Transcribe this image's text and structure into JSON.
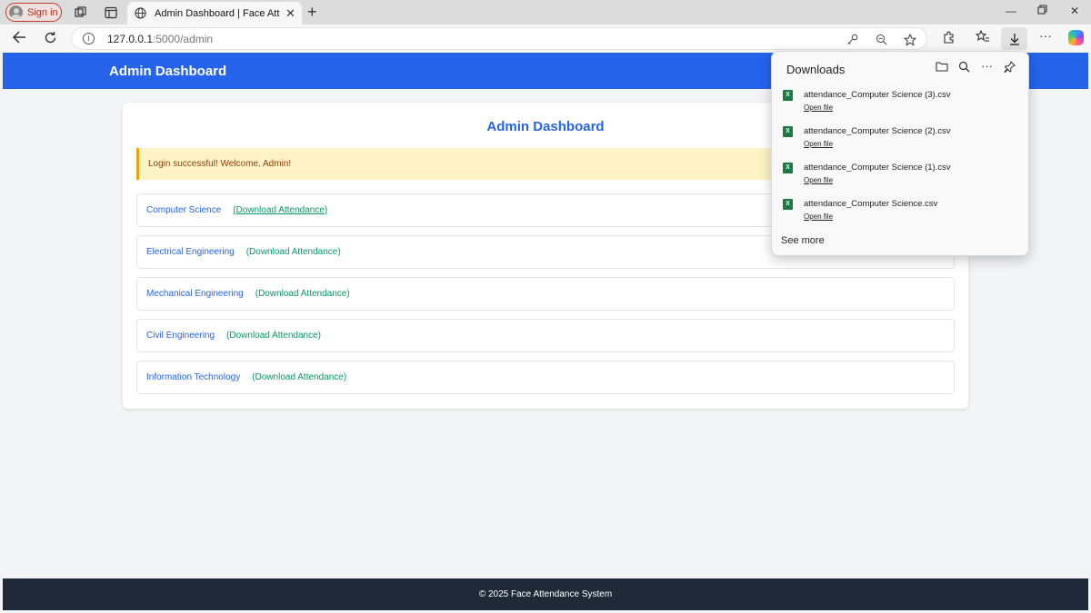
{
  "browser": {
    "signin_label": "Sign in",
    "tab_title": "Admin Dashboard | Face Attendance System",
    "url_host": "127.0.0.1",
    "url_path": ":5000/admin"
  },
  "header": {
    "brand": "Admin Dashboard"
  },
  "card": {
    "heading": "Admin Dashboard",
    "alert": "Login successful! Welcome, Admin!",
    "departments": [
      {
        "name": "Computer Science",
        "link": "(Download Attendance)"
      },
      {
        "name": "Electrical Engineering",
        "link": "(Download Attendance)"
      },
      {
        "name": "Mechanical Engineering",
        "link": "(Download Attendance)"
      },
      {
        "name": "Civil Engineering",
        "link": "(Download Attendance)"
      },
      {
        "name": "Information Technology",
        "link": "(Download Attendance)"
      }
    ]
  },
  "footer": {
    "text": "© 2025 Face Attendance System"
  },
  "downloads": {
    "title": "Downloads",
    "items": [
      {
        "file": "attendance_Computer Science (3).csv",
        "action": "Open file"
      },
      {
        "file": "attendance_Computer Science (2).csv",
        "action": "Open file"
      },
      {
        "file": "attendance_Computer Science (1).csv",
        "action": "Open file"
      },
      {
        "file": "attendance_Computer Science.csv",
        "action": "Open file"
      }
    ],
    "see_more": "See more"
  },
  "icons": {
    "workspaces": "workspaces-icon",
    "tab_actions": "tab-actions-icon",
    "globe": "globe-icon",
    "close": "close-icon",
    "new_tab": "plus-icon",
    "back": "back-arrow-icon",
    "refresh": "refresh-icon",
    "info": "info-icon",
    "key": "key-icon",
    "zoom": "zoom-icon",
    "favorite": "star-icon",
    "extensions": "puzzle-icon",
    "favorites": "favorites-icon",
    "download": "download-icon",
    "more": "more-icon",
    "copilot": "copilot-icon",
    "folder": "folder-icon",
    "search": "search-icon",
    "pin": "pin-icon",
    "excel": "excel-file-icon"
  },
  "colors": {
    "primary": "#2563eb",
    "link_green": "#059669",
    "alert_bg": "#fef3c7",
    "alert_border": "#f59e0b",
    "footer_bg": "#1f2937"
  }
}
